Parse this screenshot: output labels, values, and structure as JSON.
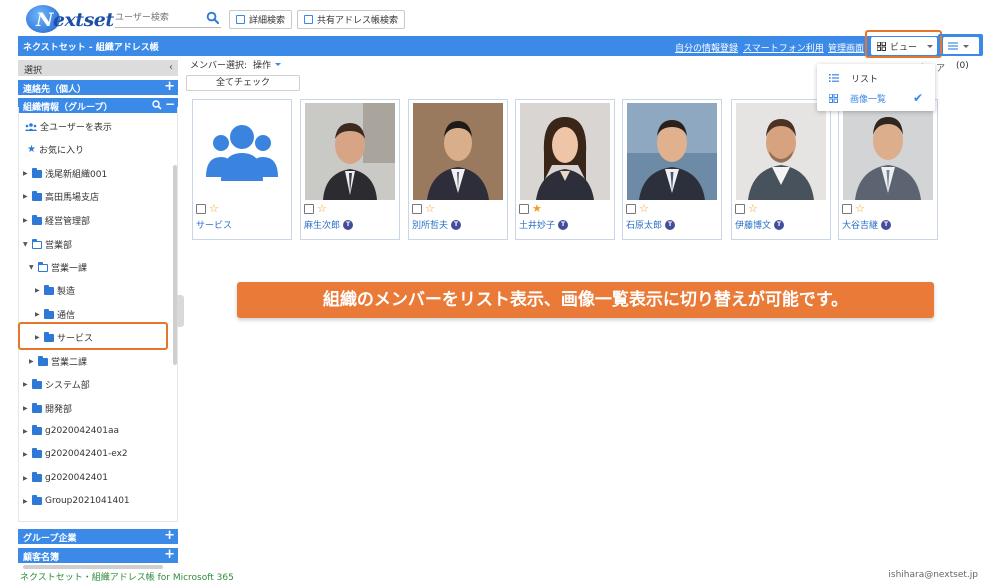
{
  "header": {
    "logo_text": "Nextset",
    "search_placeholder": "ユーザー検索",
    "detail_search": "詳細検索",
    "shared_search": "共有アドレス帳検索"
  },
  "bluebar": {
    "title": "ネクストセット - 組織アドレス帳",
    "links": [
      "自分の情報登録",
      "スマートフォン利用",
      "管理画面"
    ],
    "view_label": "ビュー"
  },
  "sidebar": {
    "select_label": "選択",
    "contacts_label": "連絡先（個人）",
    "org_label": "組織情報（グループ）",
    "all_users": "全ユーザーを表示",
    "favorites": "お気に入り",
    "tree": [
      {
        "label": "浅尾新組織001"
      },
      {
        "label": "高田馬場支店"
      },
      {
        "label": "経営管理部"
      },
      {
        "label": "営業部"
      },
      {
        "label": "営業一課"
      },
      {
        "label": "製造"
      },
      {
        "label": "通信"
      },
      {
        "label": "サービス"
      },
      {
        "label": "営業二課"
      },
      {
        "label": "システム部"
      },
      {
        "label": "開発部"
      },
      {
        "label": "g2020042401aa"
      },
      {
        "label": "g2020042401-ex2"
      },
      {
        "label": "g2020042401"
      },
      {
        "label": "Group2021041401"
      }
    ],
    "group_companies": "グループ企業",
    "customers": "顧客名簿"
  },
  "toolbar": {
    "member_select": "メンバー選択:",
    "operation": "操作",
    "check_all": "全てチェック",
    "clear": "クリア",
    "count": "(0)"
  },
  "cards": [
    {
      "name": "サービス",
      "starred": false,
      "badge": ""
    },
    {
      "name": "麻生次郎",
      "starred": false,
      "badge": "T"
    },
    {
      "name": "別所哲夫",
      "starred": false,
      "badge": "T"
    },
    {
      "name": "土井妙子",
      "starred": true,
      "badge": "T"
    },
    {
      "name": "石原太郎",
      "starred": false,
      "badge": "T"
    },
    {
      "name": "伊藤博文",
      "starred": false,
      "badge": "T"
    },
    {
      "name": "大谷吉継",
      "starred": false,
      "badge": "T"
    }
  ],
  "menu": {
    "list": "リスト",
    "image_list": "画像一覧"
  },
  "banner": "組織のメンバーをリスト表示、画像一覧表示に切り替えが可能です。",
  "footer": {
    "left": "ネクストセット・組織アドレス帳 for Microsoft 365",
    "right": "ishihara@nextset.jp"
  },
  "colors": {
    "accent": "#3b8ae8",
    "highlight": "#e7762d",
    "star": "#f0a020"
  }
}
